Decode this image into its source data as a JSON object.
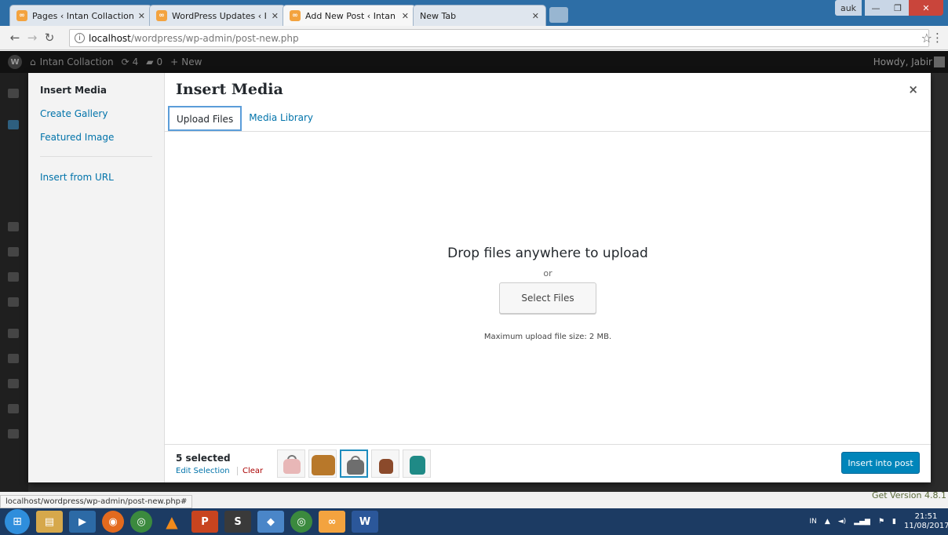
{
  "browser": {
    "tabs": [
      {
        "title": "Pages ‹ Intan Collaction -",
        "active": false
      },
      {
        "title": "WordPress Updates ‹ Inta",
        "active": false
      },
      {
        "title": "Add New Post ‹ Intan Co",
        "active": true
      },
      {
        "title": "New Tab",
        "active": false
      }
    ],
    "window_user": "auk",
    "url_host": "localhost",
    "url_path": "/wordpress/wp-admin/post-new.php",
    "status_url": "localhost/wordpress/wp-admin/post-new.php#"
  },
  "adminbar": {
    "site_name": "Intan Collaction",
    "updates_count": "4",
    "comments_count": "0",
    "new_label": "New",
    "howdy": "Howdy, Jabir"
  },
  "media_menu": {
    "items": [
      "Insert Media",
      "Create Gallery",
      "Featured Image",
      "Insert from URL"
    ]
  },
  "frame": {
    "title": "Insert Media",
    "close": "×",
    "tabs": [
      "Upload Files",
      "Media Library"
    ]
  },
  "uploader": {
    "drop_text": "Drop files anywhere to upload",
    "or_text": "or",
    "select_button": "Select Files",
    "max_size": "Maximum upload file size: 2 MB."
  },
  "toolbar": {
    "selected_count": "5 selected",
    "edit_selection": "Edit Selection",
    "clear": "Clear",
    "insert_button": "Insert into post",
    "thumb_colors": [
      "#e8b7b7",
      "#b8782a",
      "#6e6e6e",
      "#8b4a2b",
      "#1f8a86"
    ]
  },
  "footer": {
    "version": "Get Version 4.8.1"
  },
  "taskbar": {
    "lang": "IN",
    "time": "21:51",
    "date": "11/08/2017"
  }
}
